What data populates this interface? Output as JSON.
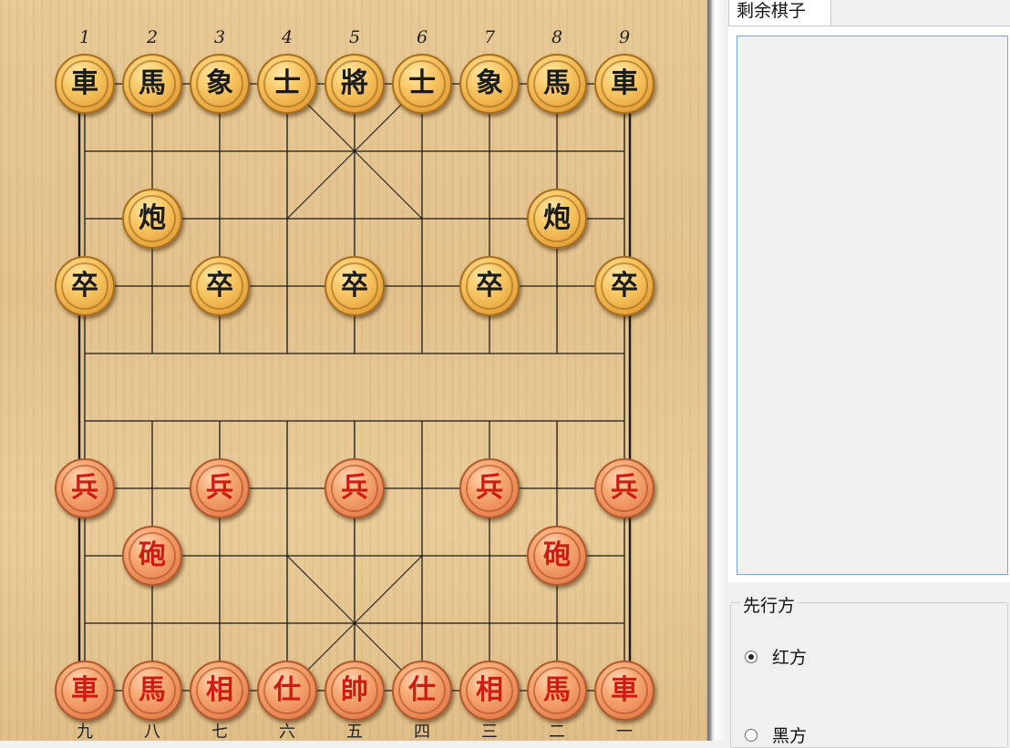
{
  "board": {
    "top_numbers": [
      "1",
      "2",
      "3",
      "4",
      "5",
      "6",
      "7",
      "8",
      "9"
    ],
    "bottom_numbers": [
      "九",
      "八",
      "七",
      "六",
      "五",
      "四",
      "三",
      "二",
      "一"
    ],
    "pieces": [
      {
        "char": "車",
        "side": "black",
        "file": 0,
        "rank": 0
      },
      {
        "char": "馬",
        "side": "black",
        "file": 1,
        "rank": 0
      },
      {
        "char": "象",
        "side": "black",
        "file": 2,
        "rank": 0
      },
      {
        "char": "士",
        "side": "black",
        "file": 3,
        "rank": 0
      },
      {
        "char": "將",
        "side": "black",
        "file": 4,
        "rank": 0
      },
      {
        "char": "士",
        "side": "black",
        "file": 5,
        "rank": 0
      },
      {
        "char": "象",
        "side": "black",
        "file": 6,
        "rank": 0
      },
      {
        "char": "馬",
        "side": "black",
        "file": 7,
        "rank": 0
      },
      {
        "char": "車",
        "side": "black",
        "file": 8,
        "rank": 0
      },
      {
        "char": "炮",
        "side": "black",
        "file": 1,
        "rank": 2
      },
      {
        "char": "炮",
        "side": "black",
        "file": 7,
        "rank": 2
      },
      {
        "char": "卒",
        "side": "black",
        "file": 0,
        "rank": 3
      },
      {
        "char": "卒",
        "side": "black",
        "file": 2,
        "rank": 3
      },
      {
        "char": "卒",
        "side": "black",
        "file": 4,
        "rank": 3
      },
      {
        "char": "卒",
        "side": "black",
        "file": 6,
        "rank": 3
      },
      {
        "char": "卒",
        "side": "black",
        "file": 8,
        "rank": 3
      },
      {
        "char": "兵",
        "side": "red",
        "file": 0,
        "rank": 6
      },
      {
        "char": "兵",
        "side": "red",
        "file": 2,
        "rank": 6
      },
      {
        "char": "兵",
        "side": "red",
        "file": 4,
        "rank": 6
      },
      {
        "char": "兵",
        "side": "red",
        "file": 6,
        "rank": 6
      },
      {
        "char": "兵",
        "side": "red",
        "file": 8,
        "rank": 6
      },
      {
        "char": "砲",
        "side": "red",
        "file": 1,
        "rank": 7
      },
      {
        "char": "砲",
        "side": "red",
        "file": 7,
        "rank": 7
      },
      {
        "char": "車",
        "side": "red",
        "file": 0,
        "rank": 9
      },
      {
        "char": "馬",
        "side": "red",
        "file": 1,
        "rank": 9
      },
      {
        "char": "相",
        "side": "red",
        "file": 2,
        "rank": 9
      },
      {
        "char": "仕",
        "side": "red",
        "file": 3,
        "rank": 9
      },
      {
        "char": "帥",
        "side": "red",
        "file": 4,
        "rank": 9
      },
      {
        "char": "仕",
        "side": "red",
        "file": 5,
        "rank": 9
      },
      {
        "char": "相",
        "side": "red",
        "file": 6,
        "rank": 9
      },
      {
        "char": "馬",
        "side": "red",
        "file": 7,
        "rank": 9
      },
      {
        "char": "車",
        "side": "red",
        "file": 8,
        "rank": 9
      }
    ]
  },
  "panel": {
    "tab_label": "剩余棋子",
    "first_move_group": {
      "title": "先行方",
      "options": [
        {
          "label": "红方",
          "selected": true
        },
        {
          "label": "黑方",
          "selected": false
        }
      ]
    }
  },
  "colors": {
    "line": "#1a1a1a",
    "red_text": "#d11a12",
    "black_text": "#1b1b1b"
  }
}
